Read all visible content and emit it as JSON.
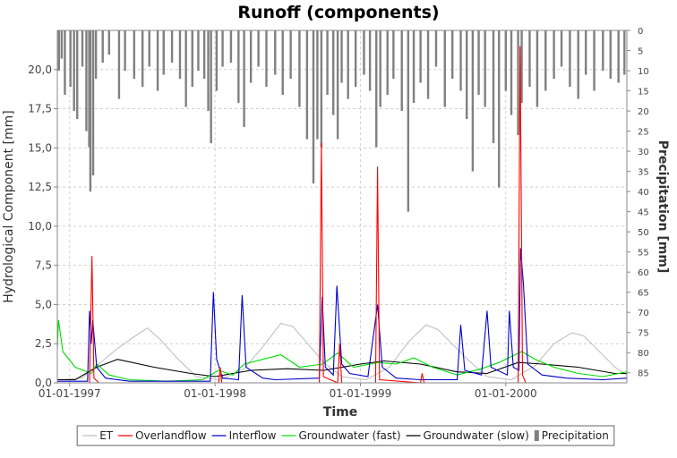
{
  "chart_data": {
    "type": "line",
    "title": "Runoff (components)",
    "xlabel": "Time",
    "ylabel_left": "Hydrological Component [mm]",
    "ylabel_right": "Precipitation [mm]",
    "x_range": [
      "1996-12-01",
      "2000-10-31"
    ],
    "x_ticks": [
      {
        "date": "1997-01-01",
        "label": "01-01-1997"
      },
      {
        "date": "1998-01-01",
        "label": "01-01-1998"
      },
      {
        "date": "1999-01-01",
        "label": "01-01-1999"
      },
      {
        "date": "2000-01-01",
        "label": "01-01-2000"
      }
    ],
    "y_left": {
      "min": 0,
      "max": 22.5,
      "ticks": [
        0,
        2.5,
        5,
        7.5,
        10,
        12.5,
        15,
        17.5,
        20
      ],
      "tick_labels": [
        "0,0",
        "2,5",
        "5,0",
        "7,5",
        "10,0",
        "12,5",
        "15,0",
        "17,5",
        "20,0"
      ]
    },
    "y_right": {
      "min": 0,
      "max": 87.5,
      "inverted": true,
      "ticks": [
        0,
        5,
        10,
        15,
        20,
        25,
        30,
        35,
        40,
        45,
        50,
        55,
        60,
        65,
        70,
        75,
        80,
        85
      ],
      "tick_labels": [
        "0",
        "5",
        "10",
        "15",
        "20",
        "25",
        "30",
        "35",
        "40",
        "45",
        "50",
        "55",
        "60",
        "65",
        "70",
        "75",
        "80",
        "85"
      ]
    },
    "grid": true,
    "legend_position": "bottom",
    "series": [
      {
        "name": "ET",
        "color": "#c0c0c0",
        "axis": "left",
        "points": [
          [
            "1996-12-01",
            0.2
          ],
          [
            "1997-02-01",
            0.3
          ],
          [
            "1997-03-15",
            1.2
          ],
          [
            "1997-05-01",
            2.2
          ],
          [
            "1997-06-15",
            3.0
          ],
          [
            "1997-07-15",
            3.5
          ],
          [
            "1997-08-15",
            2.8
          ],
          [
            "1997-10-01",
            1.5
          ],
          [
            "1997-11-15",
            0.4
          ],
          [
            "1998-01-15",
            0.2
          ],
          [
            "1998-03-15",
            0.9
          ],
          [
            "1998-05-01",
            2.3
          ],
          [
            "1998-06-15",
            3.8
          ],
          [
            "1998-07-15",
            3.6
          ],
          [
            "1998-08-15",
            2.7
          ],
          [
            "1998-10-01",
            1.3
          ],
          [
            "1998-11-15",
            0.4
          ],
          [
            "1999-01-15",
            0.2
          ],
          [
            "1999-03-15",
            1.0
          ],
          [
            "1999-05-01",
            2.6
          ],
          [
            "1999-06-15",
            3.7
          ],
          [
            "1999-07-15",
            3.4
          ],
          [
            "1999-08-15",
            2.6
          ],
          [
            "1999-10-01",
            1.4
          ],
          [
            "1999-11-15",
            0.4
          ],
          [
            "2000-01-15",
            0.2
          ],
          [
            "2000-03-15",
            1.1
          ],
          [
            "2000-05-01",
            2.5
          ],
          [
            "2000-06-15",
            3.2
          ],
          [
            "2000-07-15",
            3.0
          ],
          [
            "2000-08-15",
            2.2
          ],
          [
            "2000-10-01",
            1.0
          ],
          [
            "2000-10-31",
            0.5
          ]
        ]
      },
      {
        "name": "Overlandflow",
        "color": "#ff0000",
        "axis": "left",
        "points": [
          [
            "1996-12-01",
            0.0
          ],
          [
            "1997-02-20",
            0.0
          ],
          [
            "1997-02-26",
            8.1
          ],
          [
            "1997-03-03",
            0.3
          ],
          [
            "1997-03-15",
            0.0
          ],
          [
            "1998-01-10",
            0.0
          ],
          [
            "1998-01-14",
            1.0
          ],
          [
            "1998-01-18",
            0.0
          ],
          [
            "1998-09-20",
            0.0
          ],
          [
            "1998-09-25",
            15.3
          ],
          [
            "1998-09-30",
            0.4
          ],
          [
            "1998-11-05",
            0.0
          ],
          [
            "1998-11-10",
            2.5
          ],
          [
            "1998-11-15",
            0.0
          ],
          [
            "1999-02-08",
            0.0
          ],
          [
            "1999-02-13",
            13.8
          ],
          [
            "1999-02-18",
            0.2
          ],
          [
            "1999-06-01",
            0.0
          ],
          [
            "1999-06-05",
            0.6
          ],
          [
            "1999-06-10",
            0.0
          ],
          [
            "2000-02-01",
            0.0
          ],
          [
            "2000-02-06",
            21.5
          ],
          [
            "2000-02-12",
            0.5
          ],
          [
            "2000-02-20",
            0.0
          ],
          [
            "2000-10-31",
            0.0
          ]
        ]
      },
      {
        "name": "Interflow",
        "color": "#0000cc",
        "axis": "left",
        "points": [
          [
            "1996-12-01",
            0.1
          ],
          [
            "1997-02-15",
            0.1
          ],
          [
            "1997-02-20",
            4.6
          ],
          [
            "1997-02-24",
            2.5
          ],
          [
            "1997-02-28",
            4.0
          ],
          [
            "1997-03-10",
            1.0
          ],
          [
            "1997-04-01",
            0.3
          ],
          [
            "1997-06-01",
            0.1
          ],
          [
            "1997-12-20",
            0.1
          ],
          [
            "1997-12-28",
            5.8
          ],
          [
            "1998-01-05",
            1.5
          ],
          [
            "1998-01-20",
            0.3
          ],
          [
            "1998-03-01",
            0.2
          ],
          [
            "1998-03-10",
            5.6
          ],
          [
            "1998-03-20",
            1.0
          ],
          [
            "1998-05-01",
            0.3
          ],
          [
            "1998-06-01",
            0.2
          ],
          [
            "1998-09-20",
            0.3
          ],
          [
            "1998-09-27",
            5.5
          ],
          [
            "1998-10-05",
            1.0
          ],
          [
            "1998-10-25",
            0.5
          ],
          [
            "1998-11-03",
            6.2
          ],
          [
            "1998-11-15",
            1.2
          ],
          [
            "1998-12-05",
            0.6
          ],
          [
            "1999-01-20",
            0.4
          ],
          [
            "1999-02-13",
            5.0
          ],
          [
            "1999-02-25",
            1.0
          ],
          [
            "1999-04-01",
            0.3
          ],
          [
            "1999-06-01",
            0.2
          ],
          [
            "1999-09-01",
            0.2
          ],
          [
            "1999-09-10",
            3.7
          ],
          [
            "1999-09-20",
            0.8
          ],
          [
            "1999-11-01",
            0.5
          ],
          [
            "1999-11-15",
            4.6
          ],
          [
            "1999-11-25",
            1.0
          ],
          [
            "2000-01-05",
            0.5
          ],
          [
            "2000-01-10",
            4.6
          ],
          [
            "2000-01-20",
            1.0
          ],
          [
            "2000-02-03",
            0.8
          ],
          [
            "2000-02-07",
            8.6
          ],
          [
            "2000-02-14",
            6.4
          ],
          [
            "2000-02-25",
            1.2
          ],
          [
            "2000-04-01",
            0.5
          ],
          [
            "2000-06-01",
            0.3
          ],
          [
            "2000-09-01",
            0.2
          ],
          [
            "2000-10-31",
            0.3
          ]
        ]
      },
      {
        "name": "Groundwater (fast)",
        "color": "#00dd00",
        "axis": "left",
        "points": [
          [
            "1996-12-01",
            2.2
          ],
          [
            "1996-12-04",
            4.0
          ],
          [
            "1996-12-15",
            2.0
          ],
          [
            "1997-01-15",
            1.0
          ],
          [
            "1997-02-25",
            0.6
          ],
          [
            "1997-03-10",
            1.2
          ],
          [
            "1997-04-10",
            0.5
          ],
          [
            "1997-06-01",
            0.2
          ],
          [
            "1997-09-01",
            0.1
          ],
          [
            "1997-12-01",
            0.2
          ],
          [
            "1998-01-10",
            0.8
          ],
          [
            "1998-02-15",
            0.5
          ],
          [
            "1998-03-15",
            1.2
          ],
          [
            "1998-05-01",
            1.5
          ],
          [
            "1998-06-15",
            1.8
          ],
          [
            "1998-08-01",
            1.0
          ],
          [
            "1998-09-28",
            1.2
          ],
          [
            "1998-11-05",
            1.9
          ],
          [
            "1998-12-15",
            1.0
          ],
          [
            "1999-02-15",
            1.3
          ],
          [
            "1999-04-01",
            1.2
          ],
          [
            "1999-05-15",
            1.6
          ],
          [
            "1999-07-01",
            1.0
          ],
          [
            "1999-09-01",
            0.5
          ],
          [
            "1999-11-01",
            0.9
          ],
          [
            "1999-12-15",
            1.3
          ],
          [
            "2000-02-10",
            2.0
          ],
          [
            "2000-03-15",
            1.5
          ],
          [
            "2000-05-01",
            1.0
          ],
          [
            "2000-07-01",
            0.6
          ],
          [
            "2000-09-01",
            0.4
          ],
          [
            "2000-10-31",
            0.7
          ]
        ]
      },
      {
        "name": "Groundwater (slow)",
        "color": "#000000",
        "axis": "left",
        "points": [
          [
            "1996-12-01",
            0.2
          ],
          [
            "1997-01-15",
            0.2
          ],
          [
            "1997-03-10",
            1.0
          ],
          [
            "1997-05-01",
            1.5
          ],
          [
            "1997-08-01",
            1.0
          ],
          [
            "1997-11-01",
            0.6
          ],
          [
            "1998-01-01",
            0.4
          ],
          [
            "1998-04-01",
            0.8
          ],
          [
            "1998-07-01",
            0.9
          ],
          [
            "1998-10-01",
            0.8
          ],
          [
            "1999-01-01",
            1.2
          ],
          [
            "1999-03-01",
            1.4
          ],
          [
            "1999-06-01",
            1.2
          ],
          [
            "1999-09-01",
            0.7
          ],
          [
            "1999-11-15",
            0.6
          ],
          [
            "2000-02-01",
            1.3
          ],
          [
            "2000-04-01",
            1.2
          ],
          [
            "2000-07-01",
            1.0
          ],
          [
            "2000-10-01",
            0.6
          ],
          [
            "2000-10-31",
            0.6
          ]
        ]
      },
      {
        "name": "Precipitation",
        "color": "#808080",
        "axis": "right",
        "points": [
          [
            "1996-12-05",
            10
          ],
          [
            "1996-12-12",
            7
          ],
          [
            "1996-12-20",
            16
          ],
          [
            "1997-01-03",
            14
          ],
          [
            "1997-01-12",
            20
          ],
          [
            "1997-01-20",
            22
          ],
          [
            "1997-02-02",
            9
          ],
          [
            "1997-02-12",
            25
          ],
          [
            "1997-02-19",
            29
          ],
          [
            "1997-02-22",
            40
          ],
          [
            "1997-03-01",
            36
          ],
          [
            "1997-03-08",
            12
          ],
          [
            "1997-03-25",
            8
          ],
          [
            "1997-04-10",
            6
          ],
          [
            "1997-05-05",
            17
          ],
          [
            "1997-05-20",
            10
          ],
          [
            "1997-06-12",
            12
          ],
          [
            "1997-07-03",
            14
          ],
          [
            "1997-07-20",
            9
          ],
          [
            "1997-08-10",
            15
          ],
          [
            "1997-08-25",
            11
          ],
          [
            "1997-09-15",
            8
          ],
          [
            "1997-10-05",
            12
          ],
          [
            "1997-10-20",
            19
          ],
          [
            "1997-11-05",
            14
          ],
          [
            "1997-11-20",
            10
          ],
          [
            "1997-12-05",
            12
          ],
          [
            "1997-12-15",
            20
          ],
          [
            "1997-12-22",
            28
          ],
          [
            "1998-01-05",
            15
          ],
          [
            "1998-01-20",
            9
          ],
          [
            "1998-02-10",
            8
          ],
          [
            "1998-03-01",
            18
          ],
          [
            "1998-03-15",
            24
          ],
          [
            "1998-04-01",
            13
          ],
          [
            "1998-04-20",
            9
          ],
          [
            "1998-05-10",
            14
          ],
          [
            "1998-06-01",
            11
          ],
          [
            "1998-06-20",
            16
          ],
          [
            "1998-07-10",
            12
          ],
          [
            "1998-08-01",
            19
          ],
          [
            "1998-08-20",
            27
          ],
          [
            "1998-09-05",
            38
          ],
          [
            "1998-09-15",
            27
          ],
          [
            "1998-09-25",
            29
          ],
          [
            "1998-10-10",
            16
          ],
          [
            "1998-10-25",
            21
          ],
          [
            "1998-11-05",
            27
          ],
          [
            "1998-11-15",
            13
          ],
          [
            "1998-12-01",
            17
          ],
          [
            "1998-12-20",
            14
          ],
          [
            "1999-01-10",
            11
          ],
          [
            "1999-01-25",
            15
          ],
          [
            "1999-02-10",
            29
          ],
          [
            "1999-02-20",
            19
          ],
          [
            "1999-03-10",
            16
          ],
          [
            "1999-03-25",
            12
          ],
          [
            "1999-04-15",
            20
          ],
          [
            "1999-05-01",
            45
          ],
          [
            "1999-05-15",
            18
          ],
          [
            "1999-06-01",
            13
          ],
          [
            "1999-06-20",
            17
          ],
          [
            "1999-07-10",
            9
          ],
          [
            "1999-08-01",
            19
          ],
          [
            "1999-08-20",
            12
          ],
          [
            "1999-09-10",
            15
          ],
          [
            "1999-09-25",
            22
          ],
          [
            "1999-10-10",
            35
          ],
          [
            "1999-10-25",
            16
          ],
          [
            "1999-11-10",
            19
          ],
          [
            "1999-12-01",
            28
          ],
          [
            "1999-12-15",
            39
          ],
          [
            "2000-01-01",
            15
          ],
          [
            "2000-01-15",
            21
          ],
          [
            "2000-02-01",
            26
          ],
          [
            "2000-02-10",
            18
          ],
          [
            "2000-03-01",
            14
          ],
          [
            "2000-03-20",
            19
          ],
          [
            "2000-04-10",
            15
          ],
          [
            "2000-05-01",
            12
          ],
          [
            "2000-05-20",
            9
          ],
          [
            "2000-06-10",
            14
          ],
          [
            "2000-07-01",
            17
          ],
          [
            "2000-07-20",
            11
          ],
          [
            "2000-08-10",
            15
          ],
          [
            "2000-09-01",
            10
          ],
          [
            "2000-09-20",
            12
          ],
          [
            "2000-10-10",
            13
          ],
          [
            "2000-10-25",
            11
          ]
        ]
      }
    ]
  }
}
